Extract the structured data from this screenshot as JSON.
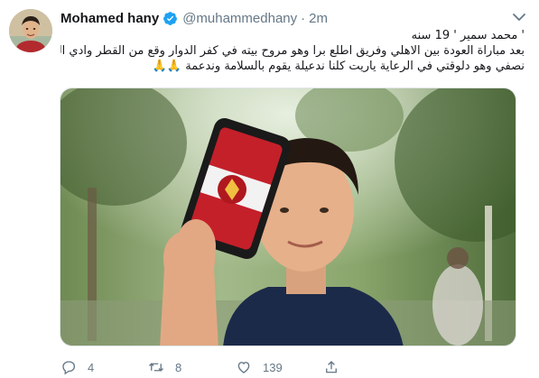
{
  "tweet": {
    "author": {
      "name": "Mohamed hany",
      "handle": "@muhammedhany",
      "verified": true,
      "avatar_icon": "avatar-photo"
    },
    "separator": "·",
    "time": "2m",
    "text_lines": [
      "' محمد سمير ' 19 سنه",
      "بعد مباراة العودة بين الاهلي وفريق اطلع برا وهو مروح بيته في كفر الدوار وقع من القطر وادي الي بتر",
      "نصفي وهو دلوقتي في الرعاية ياريت كلنا ندعيلة يقوم بالسلامة وندعمة"
    ],
    "emoji": "🙏🙏",
    "media": {
      "type": "photo",
      "description_icon": "photo-boy-holding-phone"
    },
    "actions": {
      "reply_count": "4",
      "retweet_count": "8",
      "like_count": "139"
    },
    "colors": {
      "text_primary": "#14171a",
      "text_secondary": "#657786",
      "verified_blue": "#1da1f2"
    }
  }
}
